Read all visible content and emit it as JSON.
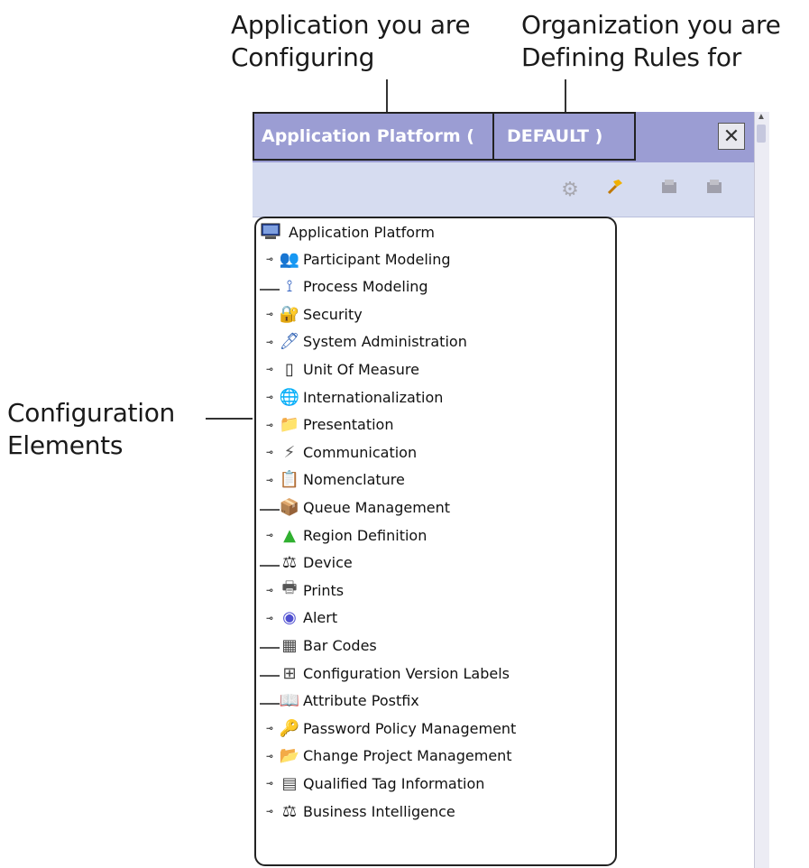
{
  "callouts": {
    "application_line1": "Application you are",
    "application_line2": "Configuring",
    "organization_line1": "Organization you are",
    "organization_line2": "Defining Rules for",
    "config_line1": "Configuration",
    "config_line2": "Elements"
  },
  "titlebar": {
    "application": "Application Platform (",
    "organization": "DEFAULT )",
    "close_icon": "close-icon"
  },
  "toolbar": {
    "buttons": [
      {
        "name": "gear-icon",
        "glyph": "⚙"
      },
      {
        "name": "hammer-icon",
        "glyph": "🔨"
      },
      {
        "name": "save-icon",
        "glyph": "🖫"
      },
      {
        "name": "save-all-icon",
        "glyph": "🖫"
      }
    ]
  },
  "tree": {
    "root": "Application Platform",
    "items": [
      {
        "label": "Participant Modeling",
        "expandable": true,
        "icon": "participant-icon",
        "glyph": "👥",
        "color": "#666666"
      },
      {
        "label": "Process Modeling",
        "expandable": false,
        "icon": "process-icon",
        "glyph": "⟟",
        "color": "#3060c0"
      },
      {
        "label": "Security",
        "expandable": true,
        "icon": "security-icon",
        "glyph": "🔐",
        "color": "#c89a20"
      },
      {
        "label": "System Administration",
        "expandable": true,
        "icon": "system-admin-icon",
        "glyph": "🖊",
        "color": "#3a6ab8"
      },
      {
        "label": "Unit Of Measure",
        "expandable": true,
        "icon": "measure-icon",
        "glyph": "▯",
        "color": "#222222"
      },
      {
        "label": "Internationalization",
        "expandable": true,
        "icon": "globe-icon",
        "glyph": "🌐",
        "color": "#2a7ad0"
      },
      {
        "label": "Presentation",
        "expandable": true,
        "icon": "presentation-icon",
        "glyph": "📁",
        "color": "#d4a020"
      },
      {
        "label": "Communication",
        "expandable": true,
        "icon": "communication-icon",
        "glyph": "⚡",
        "color": "#555555"
      },
      {
        "label": "Nomenclature",
        "expandable": true,
        "icon": "nomenclature-icon",
        "glyph": "📋",
        "color": "#3a6ab8"
      },
      {
        "label": "Queue Management",
        "expandable": false,
        "icon": "queue-icon",
        "glyph": "📦",
        "color": "#c88a20"
      },
      {
        "label": "Region Definition",
        "expandable": true,
        "icon": "region-icon",
        "glyph": "▲",
        "color": "#30b030"
      },
      {
        "label": "Device",
        "expandable": false,
        "icon": "device-icon",
        "glyph": "⚖",
        "color": "#222222"
      },
      {
        "label": "Prints",
        "expandable": true,
        "icon": "printer-icon",
        "glyph": "🖶",
        "color": "#555555"
      },
      {
        "label": "Alert",
        "expandable": true,
        "icon": "alert-icon",
        "glyph": "◉",
        "color": "#5050d0"
      },
      {
        "label": "Bar Codes",
        "expandable": false,
        "icon": "barcode-icon",
        "glyph": "▦",
        "color": "#444444"
      },
      {
        "label": "Configuration Version Labels",
        "expandable": false,
        "icon": "table-icon",
        "glyph": "⊞",
        "color": "#444444"
      },
      {
        "label": "Attribute Postfix",
        "expandable": false,
        "icon": "attribute-icon",
        "glyph": "📖",
        "color": "#3a6ab8"
      },
      {
        "label": "Password Policy Management",
        "expandable": true,
        "icon": "password-icon",
        "glyph": "🔑",
        "color": "#555555"
      },
      {
        "label": "Change Project Management",
        "expandable": true,
        "icon": "change-project-icon",
        "glyph": "📂",
        "color": "#c8a020"
      },
      {
        "label": "Qualified Tag Information",
        "expandable": true,
        "icon": "tag-icon",
        "glyph": "▤",
        "color": "#444444"
      },
      {
        "label": "Business Intelligence",
        "expandable": true,
        "icon": "bi-icon",
        "glyph": "⚖",
        "color": "#222222"
      }
    ]
  }
}
